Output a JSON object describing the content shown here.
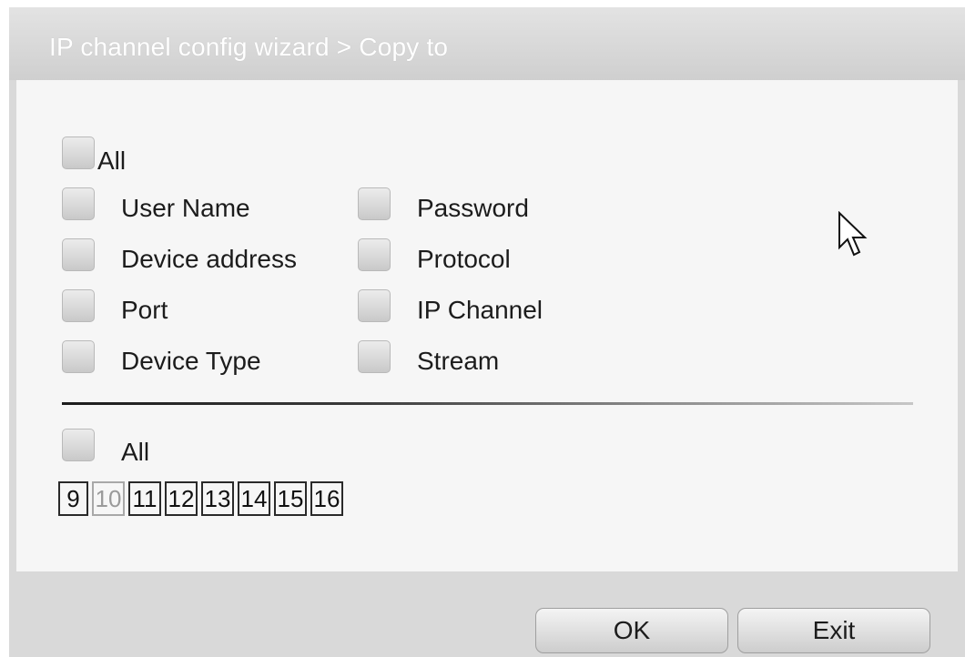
{
  "window": {
    "title": "IP channel config wizard > Copy to"
  },
  "params": {
    "all_label": "All",
    "left": [
      "User Name",
      "Device address",
      "Port",
      "Device Type"
    ],
    "right": [
      "Password",
      "Protocol",
      "IP Channel",
      "Stream"
    ]
  },
  "channels": {
    "all_label": "All",
    "items": [
      "9",
      "10",
      "11",
      "12",
      "13",
      "14",
      "15",
      "16"
    ],
    "disabled": [
      "10"
    ]
  },
  "buttons": {
    "ok": "OK",
    "exit": "Exit"
  }
}
